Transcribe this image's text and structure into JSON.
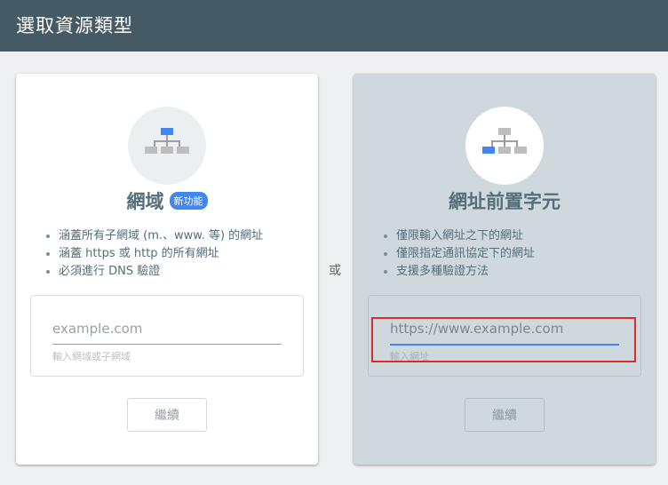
{
  "header": {
    "title": "選取資源類型"
  },
  "or_label": "或",
  "domain_card": {
    "title": "網域",
    "badge": "新功能",
    "icon": "sitemap-icon",
    "features": [
      "涵蓋所有子網域 (m.、www. 等) 的網址",
      "涵蓋 https 或 http 的所有網址",
      "必須進行 DNS 驗證"
    ],
    "input": {
      "value": "",
      "placeholder": "example.com"
    },
    "hint": "輸入網域或子網域",
    "button_label": "繼續"
  },
  "prefix_card": {
    "title": "網址前置字元",
    "icon": "sitemap-icon",
    "features": [
      "僅限輸入網址之下的網址",
      "僅限指定通訊協定下的網址",
      "支援多種驗證方法"
    ],
    "input": {
      "value": "",
      "placeholder": "https://www.example.com"
    },
    "hint": "輸入網址",
    "button_label": "繼續"
  },
  "colors": {
    "header_bg": "#455a64",
    "accent": "#4285f4",
    "selected_card_bg": "#cfd8dc",
    "highlight": "#d32f2f"
  }
}
